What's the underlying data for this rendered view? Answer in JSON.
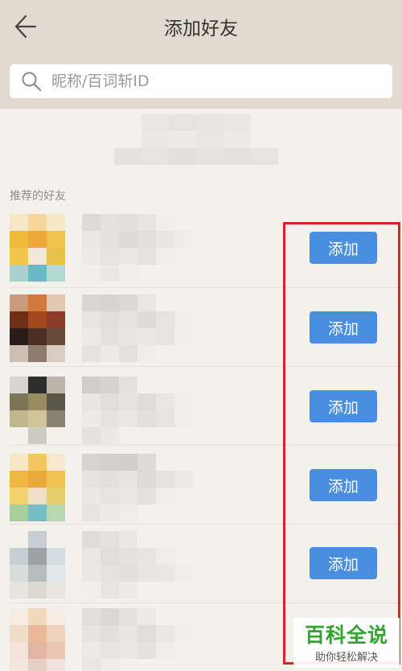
{
  "header": {
    "title": "添加好友",
    "back_icon": "arrow-left-icon"
  },
  "search": {
    "placeholder": "昵称/百词斩ID",
    "icon": "search-icon"
  },
  "section": {
    "recommended_label": "推荐的好友"
  },
  "friends": [
    {
      "add_label": "添加"
    },
    {
      "add_label": "添加"
    },
    {
      "add_label": "添加"
    },
    {
      "add_label": "添加"
    },
    {
      "add_label": "添加"
    },
    {
      "add_label": ""
    }
  ],
  "watermark": {
    "title": "百科全说",
    "subtitle": "助你轻松解决"
  },
  "colors": {
    "header_bg": "#e2d9cf",
    "page_bg": "#f3f1ec",
    "accent_button": "#4a8ee0",
    "highlight_frame": "#d8232a",
    "watermark_green": "#2fa52f"
  }
}
